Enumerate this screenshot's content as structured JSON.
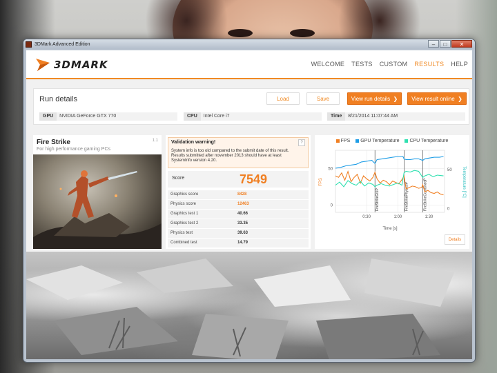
{
  "window": {
    "title": "3DMark Advanced Edition",
    "controls": {
      "minimize": "–",
      "maximize": "□",
      "close": "✕"
    }
  },
  "header": {
    "logo_text": "3DMARK",
    "nav": [
      "WELCOME",
      "TESTS",
      "CUSTOM",
      "RESULTS",
      "HELP"
    ],
    "active_nav": "RESULTS"
  },
  "run_details": {
    "title": "Run details",
    "load_label": "Load",
    "save_label": "Save",
    "view_run_label": "View run details",
    "view_online_label": "View result online",
    "gpu_label": "GPU",
    "gpu_value": "NVIDIA GeForce GTX 770",
    "cpu_label": "CPU",
    "cpu_value": "Intel Core i7",
    "time_label": "Time",
    "time_value": "8/21/2014 11:07:44 AM"
  },
  "test": {
    "name": "Fire Strike",
    "subtitle": "For high performance gaming PCs",
    "version": "1.1"
  },
  "warning": {
    "title": "Validation warning!",
    "help": "?",
    "text": "System info is too old compared to the submit date of this result. Results submitted after november 2013 should have at least SystemInfo version 4.20."
  },
  "scores": {
    "score_label": "Score",
    "score_value": "7549",
    "rows": [
      {
        "label": "Graphics score",
        "value": "8428"
      },
      {
        "label": "Physics score",
        "value": "12463"
      },
      {
        "label": "Graphics test 1",
        "value": "40.66"
      },
      {
        "label": "Graphics test 2",
        "value": "33.35"
      },
      {
        "label": "Physics test",
        "value": "39.63"
      },
      {
        "label": "Combined test",
        "value": "14.79"
      }
    ]
  },
  "chart": {
    "details_label": "Details",
    "colors": {
      "fps": "#f07f22",
      "gpu": "#1e9de6",
      "cpu": "#2fe0b0"
    }
  },
  "chart_data": {
    "type": "line",
    "xlabel": "Time [s]",
    "ylabel_left": "FPS",
    "ylabel_right": "Temperature [°C]",
    "x_ticks": [
      "0:30",
      "1:00",
      "1:30"
    ],
    "y_left_ticks": [
      "0",
      "50"
    ],
    "y_right_ticks": [
      "0",
      "50"
    ],
    "xlim": [
      0,
      105
    ],
    "ylim_left": [
      -10,
      75
    ],
    "ylim_right": [
      -5,
      75
    ],
    "legend": [
      "FPS",
      "GPU Temperature",
      "CPU Temperature"
    ],
    "legend_position": "top",
    "markers": [
      {
        "x": 38,
        "label": "FireStrikeGt1P"
      },
      {
        "x": 66,
        "label": "FireStrikePhysicsP"
      },
      {
        "x": 84,
        "label": "FireStrikeCombinedP"
      }
    ],
    "series": [
      {
        "name": "FPS",
        "axis": "left",
        "x": [
          0,
          3,
          6,
          9,
          12,
          15,
          18,
          21,
          24,
          27,
          30,
          33,
          36,
          38,
          40,
          43,
          46,
          49,
          52,
          55,
          58,
          61,
          64,
          66,
          68,
          71,
          74,
          77,
          80,
          83,
          84,
          86,
          89,
          92,
          95,
          98,
          101,
          104
        ],
        "values": [
          40,
          38,
          44,
          34,
          46,
          32,
          38,
          42,
          30,
          40,
          36,
          33,
          38,
          45,
          36,
          30,
          34,
          32,
          28,
          33,
          31,
          29,
          35,
          40,
          22,
          24,
          26,
          25,
          23,
          24,
          28,
          18,
          20,
          17,
          16,
          18,
          15,
          14
        ]
      },
      {
        "name": "GPU Temperature",
        "axis": "right",
        "x": [
          0,
          5,
          10,
          15,
          20,
          25,
          30,
          35,
          38,
          40,
          45,
          50,
          55,
          60,
          65,
          66,
          68,
          72,
          76,
          80,
          84,
          86,
          90,
          95,
          100,
          104
        ],
        "values": [
          52,
          53,
          55,
          56,
          57,
          60,
          61,
          62,
          58,
          63,
          64,
          65,
          66,
          67,
          67,
          64,
          63,
          63,
          64,
          64,
          62,
          64,
          65,
          66,
          66,
          67
        ]
      },
      {
        "name": "CPU Temperature",
        "axis": "right",
        "x": [
          0,
          4,
          8,
          12,
          16,
          20,
          24,
          28,
          32,
          36,
          38,
          40,
          44,
          48,
          52,
          56,
          60,
          64,
          66,
          68,
          72,
          76,
          80,
          84,
          86,
          90,
          94,
          98,
          104
        ],
        "values": [
          30,
          34,
          28,
          36,
          32,
          30,
          35,
          29,
          33,
          31,
          28,
          30,
          32,
          30,
          29,
          31,
          33,
          30,
          46,
          48,
          47,
          49,
          48,
          40,
          42,
          44,
          41,
          43,
          42
        ]
      }
    ]
  }
}
